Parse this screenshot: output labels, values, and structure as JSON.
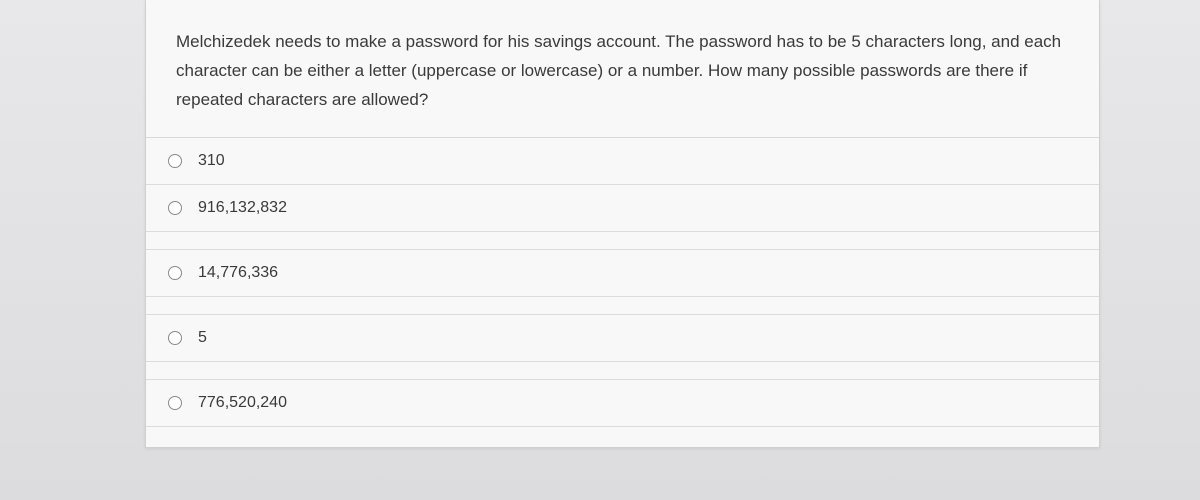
{
  "question": {
    "text": "Melchizedek needs to make a password for his savings account.  The password has to be 5 characters long, and each character can be either a letter (uppercase or lowercase) or a number. How many possible passwords are there if repeated characters are allowed?"
  },
  "options": [
    {
      "label": "310"
    },
    {
      "label": "916,132,832"
    },
    {
      "label": "14,776,336"
    },
    {
      "label": "5"
    },
    {
      "label": "776,520,240"
    }
  ]
}
